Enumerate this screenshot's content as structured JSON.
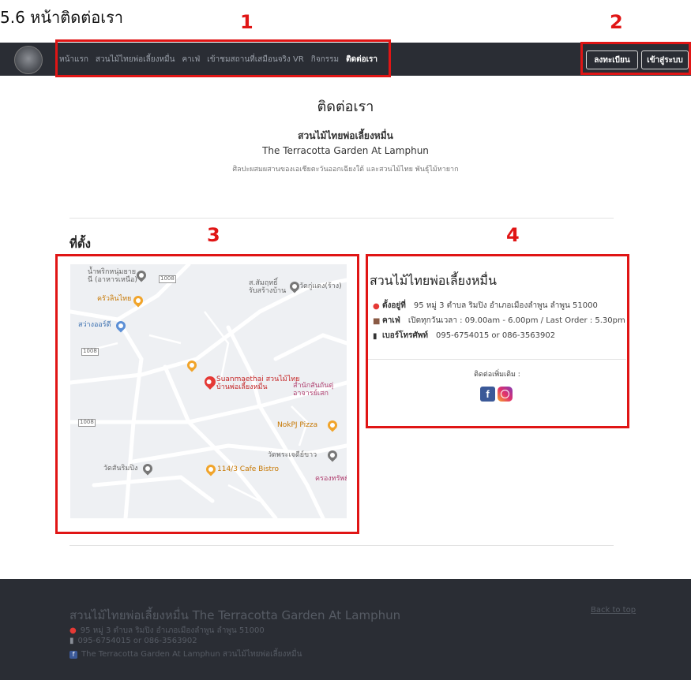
{
  "caption": "5.6 หน้าติดต่อเรา",
  "annotations": [
    "1",
    "2",
    "3",
    "4"
  ],
  "nav": {
    "links": [
      "หน้าแรก",
      "สวนไม้ไทยพ่อเลี้ยงหมื่น",
      "คาเฟ่",
      "เข้าชมสถานที่เสมือนจริง VR",
      "กิจกรรม",
      "ติดต่อเรา"
    ],
    "register": "ลงทะเบียน",
    "login": "เข้าสู่ระบบ"
  },
  "header": {
    "title": "ติดต่อเรา",
    "name_th": "สวนไม้ไทยพ่อเลี้ยงหมื่น",
    "name_en": "The Terracotta Garden At Lamphun",
    "tagline": "ศิลปะผสมผสานของเอเชียตะวันออกเฉียงใต้ และสวนไม้ไทย พันธุ์ไม้หายาก"
  },
  "location": {
    "heading": "ที่ตั้ง",
    "map_labels": {
      "l1": "น้ำพริกหนุ่มยาย\nนี (อาหารเหนือ)",
      "l2": "ส.สัมฤทธิ์\nรับสร้างบ้าน",
      "l3": "วัดกู่แดง(ร้าง)",
      "l4": "ครัวลินไทย",
      "l5": "สว่างออร์ดี",
      "l6": "Suanmaethai สวนไม้ไทย\nบ้านพ่อเลี้ยงหมื่น",
      "l7": "สำนักสันถันตุ่\nอาจารย์เสก",
      "l8": "NokPJ Pizza",
      "l9": "วัดพระเจดีย์ขาว",
      "l10": "วัดสันริมปิง",
      "l11": "114/3 Cafe Bistro",
      "l12": "ครองทรัพย์",
      "road1": "1008",
      "road2": "1008",
      "road3": "1008"
    }
  },
  "info": {
    "title": "สวนไม้ไทยพ่อเลี้ยงหมื่น",
    "address_label": "ตั้งอยู่ที่",
    "address": "95 หมู่ 3 ตำบล ริมปิง อำเภอเมืองลำพูน ลำพูน 51000",
    "cafe_label": "คาเฟ่",
    "cafe": "เปิดทุกวันเวลา : 09.00am - 6.00pm / Last Order : 5.30pm",
    "phone_label": "เบอร์โทรศัพท์",
    "phone": "095-6754015 or 086-3563902",
    "more": "ติดต่อเพิ่มเติม :"
  },
  "footer": {
    "title": "สวนไม้ไทยพ่อเลี้ยงหมื่น The Terracotta Garden At Lamphun",
    "address": "95 หมู่ 3 ตำบล ริมปิง อำเภอเมืองลำพูน ลำพูน 51000",
    "phone": "095-6754015 or 086-3563902",
    "facebook": "The Terracotta Garden At Lamphun สวนไม้ไทยพ่อเลี้ยงหมื่น",
    "back_to_top": "Back to top"
  },
  "colors": {
    "annotation": "#e01515",
    "navbar": "#2a2d34",
    "facebook": "#3b5998",
    "instagram": "#c13584",
    "pin": "#e53935"
  }
}
